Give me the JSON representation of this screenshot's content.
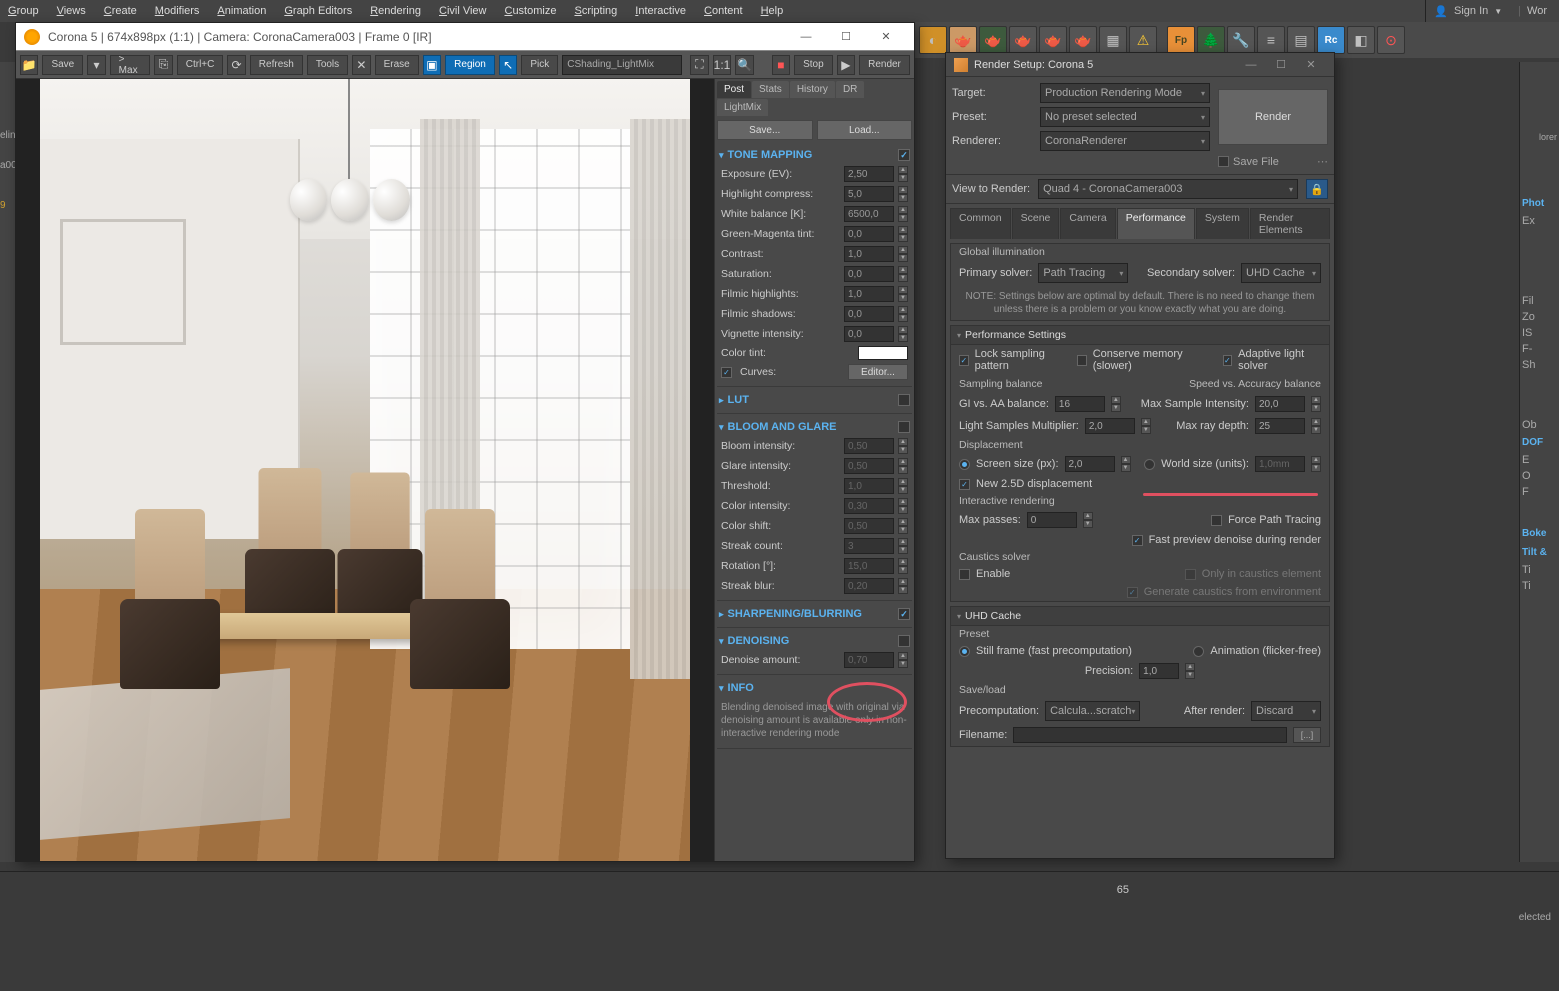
{
  "main_menu": [
    "Group",
    "Views",
    "Create",
    "Modifiers",
    "Animation",
    "Graph Editors",
    "Rendering",
    "Civil View",
    "Customize",
    "Scripting",
    "Interactive",
    "Content",
    "Help"
  ],
  "signin": {
    "label": "Sign In",
    "dropdown": "▼",
    "wor": "Wor"
  },
  "vfb": {
    "title": "Corona 5 | 674x898px (1:1) | Camera: CoronaCamera003 | Frame 0 [IR]",
    "toolbar": {
      "save": "Save",
      "tomax": "> Max",
      "ctrlc": "Ctrl+C",
      "refresh": "Refresh",
      "tools": "Tools",
      "region": "Region",
      "pick": "Pick",
      "channel": "CShading_LightMix",
      "stop": "Stop",
      "render": "Render"
    },
    "tabs": [
      "Post",
      "Stats",
      "History",
      "DR",
      "LightMix"
    ],
    "active_tab": "Post",
    "actions": {
      "save": "Save...",
      "load": "Load..."
    },
    "sections": {
      "tone_mapping": {
        "title": "TONE MAPPING",
        "enabled": true,
        "params": [
          {
            "label": "Exposure (EV):",
            "value": "2,50"
          },
          {
            "label": "Highlight compress:",
            "value": "5,0"
          },
          {
            "label": "White balance [K]:",
            "value": "6500,0"
          },
          {
            "label": "Green-Magenta tint:",
            "value": "0,0"
          },
          {
            "label": "Contrast:",
            "value": "1,0"
          },
          {
            "label": "Saturation:",
            "value": "0,0"
          },
          {
            "label": "Filmic highlights:",
            "value": "1,0"
          },
          {
            "label": "Filmic shadows:",
            "value": "0,0"
          },
          {
            "label": "Vignette intensity:",
            "value": "0,0"
          }
        ],
        "color_tint": "Color tint:",
        "curves": "Curves:",
        "editor": "Editor..."
      },
      "lut": {
        "title": "LUT",
        "enabled": false
      },
      "bloom": {
        "title": "BLOOM AND GLARE",
        "enabled": false,
        "params": [
          {
            "label": "Bloom intensity:",
            "value": "0,50"
          },
          {
            "label": "Glare intensity:",
            "value": "0,50"
          },
          {
            "label": "Threshold:",
            "value": "1,0"
          },
          {
            "label": "Color intensity:",
            "value": "0,30"
          },
          {
            "label": "Color shift:",
            "value": "0,50"
          },
          {
            "label": "Streak count:",
            "value": "3"
          },
          {
            "label": "Rotation [°]:",
            "value": "15,0"
          },
          {
            "label": "Streak blur:",
            "value": "0,20"
          }
        ]
      },
      "sharpening": {
        "title": "SHARPENING/BLURRING",
        "enabled": true
      },
      "denoising": {
        "title": "DENOISING",
        "enabled": false,
        "amount_label": "Denoise amount:",
        "amount_value": "0,70"
      },
      "info": {
        "title": "INFO",
        "text": "Blending denoised image with original via denoising amount is available only in non-interactive rendering mode"
      }
    }
  },
  "render_setup": {
    "title": "Render Setup: Corona 5",
    "target_label": "Target:",
    "target_value": "Production Rendering Mode",
    "preset_label": "Preset:",
    "preset_value": "No preset selected",
    "renderer_label": "Renderer:",
    "renderer_value": "CoronaRenderer",
    "render_btn": "Render",
    "save_file": "Save File",
    "view_label": "View to Render:",
    "view_value": "Quad 4 - CoronaCamera003",
    "tabs": [
      "Common",
      "Scene",
      "Camera",
      "Performance",
      "System",
      "Render Elements"
    ],
    "active_tab": "Performance",
    "gi": {
      "title": "Global illumination",
      "primary_label": "Primary solver:",
      "primary_value": "Path Tracing",
      "secondary_label": "Secondary solver:",
      "secondary_value": "UHD Cache",
      "note": "NOTE: Settings below are optimal by default. There is no need to change them unless there is a problem or you know exactly what you are doing."
    },
    "perf": {
      "title": "Performance Settings",
      "lock_sampling": "Lock sampling pattern",
      "conserve": "Conserve memory (slower)",
      "adaptive": "Adaptive light solver",
      "sampling_balance": "Sampling balance",
      "speed_accuracy": "Speed vs. Accuracy balance",
      "gi_aa_label": "GI vs. AA balance:",
      "gi_aa_value": "16",
      "max_sample_label": "Max Sample Intensity:",
      "max_sample_value": "20,0",
      "light_samples_label": "Light Samples Multiplier:",
      "light_samples_value": "2,0",
      "ray_depth_label": "Max ray depth:",
      "ray_depth_value": "25"
    },
    "disp": {
      "title": "Displacement",
      "screen_label": "Screen size (px):",
      "screen_value": "2,0",
      "world_label": "World size (units):",
      "world_value": "1,0mm",
      "new_25d": "New 2.5D displacement"
    },
    "ir": {
      "title": "Interactive rendering",
      "max_passes_label": "Max passes:",
      "max_passes_value": "0",
      "force_pt": "Force Path Tracing",
      "fast_denoise": "Fast preview denoise during render"
    },
    "caustics": {
      "title": "Caustics solver",
      "enable": "Enable",
      "only_caustics": "Only in caustics element",
      "gen_env": "Generate caustics from environment"
    },
    "uhd": {
      "title": "UHD Cache",
      "preset": "Preset",
      "still": "Still frame (fast precomputation)",
      "anim": "Animation (flicker-free)",
      "precision_label": "Precision:",
      "precision_value": "1,0",
      "saveload": "Save/load",
      "precomp_label": "Precomputation:",
      "precomp_value": "Calcula...scratch",
      "after_label": "After render:",
      "after_value": "Discard",
      "filename_label": "Filename:",
      "browse": "[...]"
    }
  },
  "far_right": [
    "Phot",
    "Ex",
    "Fil",
    "Zo",
    "IS",
    "F-",
    "Sh",
    "Ob",
    "DOF",
    "E",
    "O",
    "F",
    "Boke",
    "Tilt &",
    "Ti",
    "Ti"
  ],
  "left_labels": {
    "elin": "elin",
    "a00": "a00",
    "nine": "9",
    "wo": "Wo"
  },
  "bottom": {
    "num": "65",
    "selected": "elected"
  }
}
